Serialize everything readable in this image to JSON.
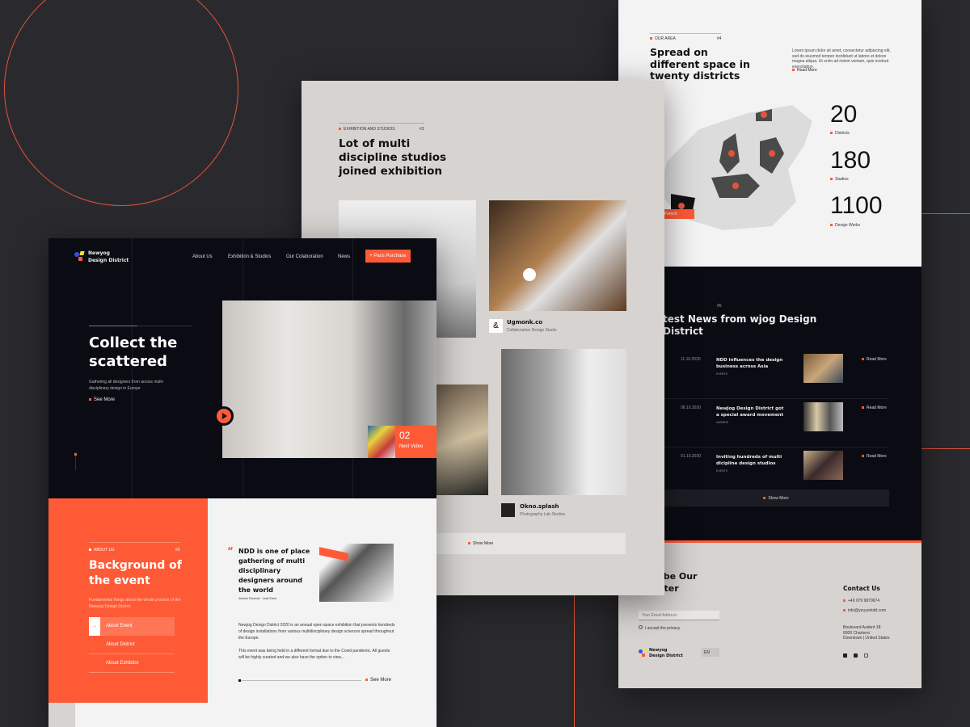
{
  "colors": {
    "accent": "#ff5a36",
    "dark": "#0b0b14",
    "light": "#f4f3f3",
    "gray": "#d6d3d0",
    "background": "#2a2a2e"
  },
  "area": {
    "eyebrow": "OUR AREA",
    "index": "#4",
    "title": "Spread on different space in twenty districts",
    "body": "Lorem ipsum dolor sit amet, consectetur adipiscing elit, sed do eiusmod tempor incididunt ut labore et dolore magna aliqua. Ut enim ad minim veniam, quis nostrud exercitation.",
    "read_more": "Read More",
    "map_tooltip": "French",
    "stats": [
      {
        "value": "20",
        "label": "Districts",
        "icon": "flag-icon"
      },
      {
        "value": "180",
        "label": "Studios",
        "icon": "pin-icon"
      },
      {
        "value": "1100",
        "label": "Design Works",
        "icon": "book-icon"
      }
    ]
  },
  "news": {
    "index": "#5",
    "title": "test News from wjog Design District",
    "items": [
      {
        "date": "11.10.2020",
        "title": "NDD influences the design business across Asia",
        "tag": "EVENTS",
        "read_more": "Read More"
      },
      {
        "date": "08.10.2020",
        "title": "NewJog Design District got a special award movement",
        "tag": "AWARDS",
        "read_more": "Read More"
      },
      {
        "date": "01.10.2020",
        "title": "Inviting hundreds of multi dicipline design studios",
        "tag": "EVENTS",
        "read_more": "Read More"
      }
    ],
    "show_more": "Show More"
  },
  "footer": {
    "subscribe_title": "cribe Our letter",
    "email_placeholder": "Your Email Address",
    "privacy": "I accept the privacy",
    "brand_line1": "Newyog",
    "brand_line2": "Design District",
    "lang": "EN",
    "contact_title": "Contact Us",
    "phone": "+49 079 9870674",
    "email": "info@youyorkdd.com",
    "address1": "Boulevard Audent 18",
    "address2": "6000 Charleroi",
    "address3": "Downtown | United States",
    "socials": [
      "facebook-icon",
      "youtube-icon",
      "instagram-icon"
    ]
  },
  "exhibition": {
    "eyebrow": "EXHIBITION AND STUDIOS",
    "index": "#3",
    "title": "Lot of multi discipline studios joined exhibition",
    "studios": [
      {
        "name": "Ugmonk.co",
        "desc": "Collaborative Design Studio"
      },
      {
        "name": "Okno.splash",
        "desc": "Photography Lab Studios"
      }
    ],
    "show_more": "Show More"
  },
  "hero": {
    "brand_line1": "Newyog",
    "brand_line2": "Design District",
    "nav": [
      "About Us",
      "Exhibition & Studios",
      "Our Colaboration",
      "News"
    ],
    "cta": "+ Pass Purchase",
    "title": "Collect the scattered",
    "subtitle": "Gathering all designers from across multi-disciplinary design in Europe",
    "see_more": "See More",
    "video_number": "02",
    "next_video": "Next Video"
  },
  "about": {
    "eyebrow": "ABOUT US",
    "index": "#2",
    "title": "Background of the event",
    "subtitle": "Fundamental things about the whole process of the Newyog Design District",
    "menu": [
      "About Event",
      "About District",
      "About Exhibitor"
    ],
    "quote": "NDD is one of place gathering of multi disciplinary designers around the world",
    "quote_author": "Andrew Parubski · Lead Event",
    "para1": "Newjog Design District 2020 is an annual open space exhibition that presents hundreds of design installations from various multidisciplinary design sciences spread throughout the Europe.",
    "para2": "This event was being held in a different format due to the Covid pandemic. All guests will be highly curated and we also have the option to view...",
    "see_more": "See More"
  }
}
